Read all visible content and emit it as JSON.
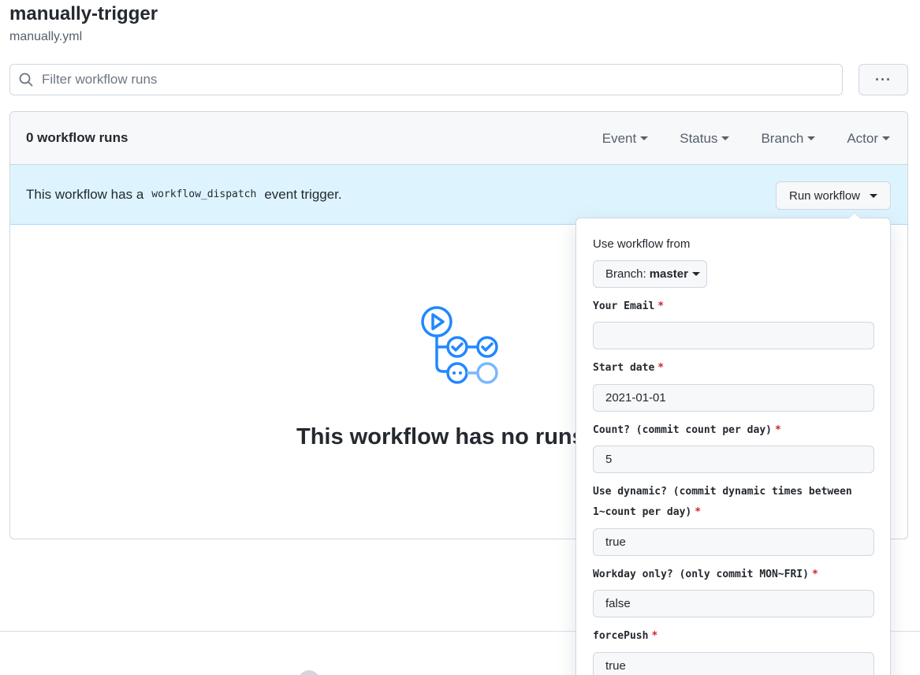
{
  "header": {
    "title": "manually-trigger",
    "subtitle": "manually.yml"
  },
  "search": {
    "placeholder": "Filter workflow runs",
    "more_label": "···"
  },
  "runs": {
    "count_label": "0 workflow runs",
    "filters": [
      "Event",
      "Status",
      "Branch",
      "Actor"
    ]
  },
  "banner": {
    "text_before": "This workflow has a",
    "code": "workflow_dispatch",
    "text_after": "event trigger.",
    "run_button": "Run workflow"
  },
  "empty_state": {
    "title": "This workflow has no runs yet."
  },
  "dispatch_panel": {
    "use_label": "Use workflow from",
    "branch_prefix": "Branch:",
    "branch_name": "master",
    "required_mark": "*",
    "fields": [
      {
        "label": "Your Email",
        "value": ""
      },
      {
        "label": "Start date",
        "value": "2021-01-01"
      },
      {
        "label": "Count? (commit count per day)",
        "value": "5"
      },
      {
        "label": "Use dynamic? (commit dynamic times between 1~count per day)",
        "value": "true"
      },
      {
        "label": "Workday only? (only commit MON~FRI)",
        "value": "false"
      },
      {
        "label": "forcePush",
        "value": "true"
      }
    ]
  },
  "colors": {
    "banner_bg": "#ddf4ff",
    "icon_blue": "#2188ff",
    "required_red": "#cf222e"
  }
}
